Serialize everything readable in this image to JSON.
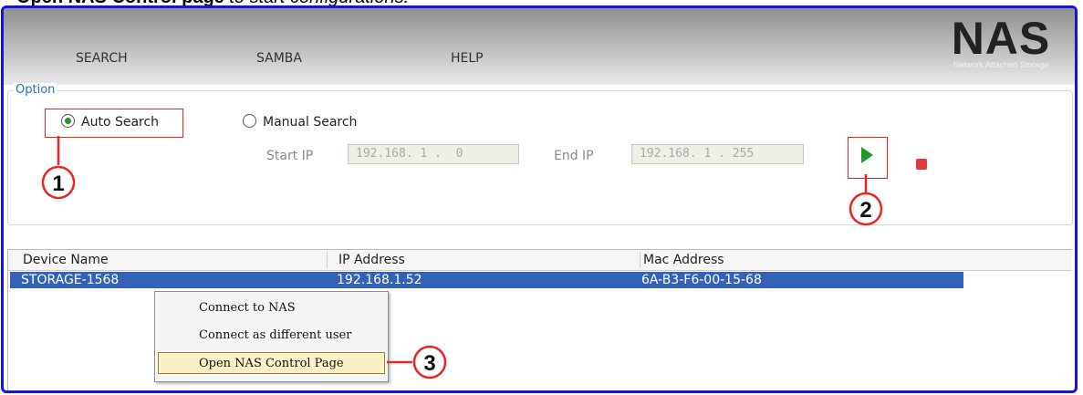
{
  "caption": {
    "bold": "Open NAS Control page",
    "rest": " to start configurations."
  },
  "menu": [
    "SEARCH",
    "SAMBA",
    "HELP"
  ],
  "logo": {
    "title": "NAS",
    "subtitle": "Network Attached Storage"
  },
  "option": {
    "legend": "Option",
    "auto_search": "Auto Search",
    "manual_search": "Manual Search",
    "start_ip_label": "Start IP",
    "start_ip": "192.168. 1 .  0",
    "end_ip_label": "End IP",
    "end_ip": "192.168. 1 . 255"
  },
  "table": {
    "headers": [
      "Device Name",
      "IP Address",
      "Mac Address"
    ],
    "rows": [
      [
        "STORAGE-1568",
        "192.168.1.52",
        "6A-B3-F6-00-15-68"
      ]
    ]
  },
  "context_menu": [
    "Connect to NAS",
    "Connect as different user",
    "Open NAS Control Page"
  ],
  "callouts": [
    "1",
    "2",
    "3"
  ],
  "colors": {
    "frame": "#1515d8",
    "highlight": "#e22222",
    "row": "#3363b8",
    "play": "#1f9a2a",
    "stop": "#e03a3a"
  }
}
